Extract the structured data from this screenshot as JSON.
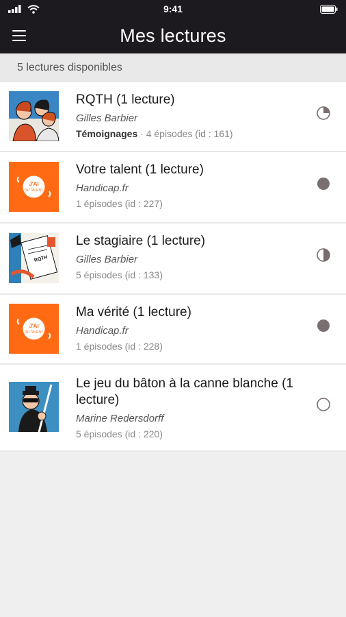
{
  "status_bar": {
    "time": "9:41"
  },
  "header": {
    "title": "Mes lectures"
  },
  "subheader": {
    "count_text": "5 lectures disponibles"
  },
  "items": [
    {
      "title": "RQTH (1 lecture)",
      "author": "Gilles Barbier",
      "category": "Témoignages",
      "separator": " · ",
      "meta": "4 épisodes (id : 161)",
      "progress": 0.25,
      "thumb": "illustration"
    },
    {
      "title": "Votre talent (1 lecture)",
      "author": "Handicap.fr",
      "category": "",
      "separator": "",
      "meta": " 1 épisodes (id : 227)",
      "progress": 1.0,
      "thumb": "orange-logo"
    },
    {
      "title": "Le stagiaire (1 lecture)",
      "author": "Gilles Barbier",
      "category": "",
      "separator": "",
      "meta": " 5 épisodes (id : 133)",
      "progress": 0.5,
      "thumb": "stagiaire"
    },
    {
      "title": "Ma vérité (1 lecture)",
      "author": "Handicap.fr",
      "category": "",
      "separator": "",
      "meta": " 1 épisodes (id : 228)",
      "progress": 1.0,
      "thumb": "orange-logo"
    },
    {
      "title": "Le jeu du bâton à la canne blanche (1 lecture)",
      "author": "Marine Redersdorff",
      "category": "",
      "separator": "",
      "meta": " 5 épisodes (id : 220)",
      "progress": 0.0,
      "thumb": "canne"
    }
  ],
  "colors": {
    "header_bg": "#1c1a1e",
    "status_fill": "#7a6f6f",
    "orange": "#ff6a13"
  }
}
